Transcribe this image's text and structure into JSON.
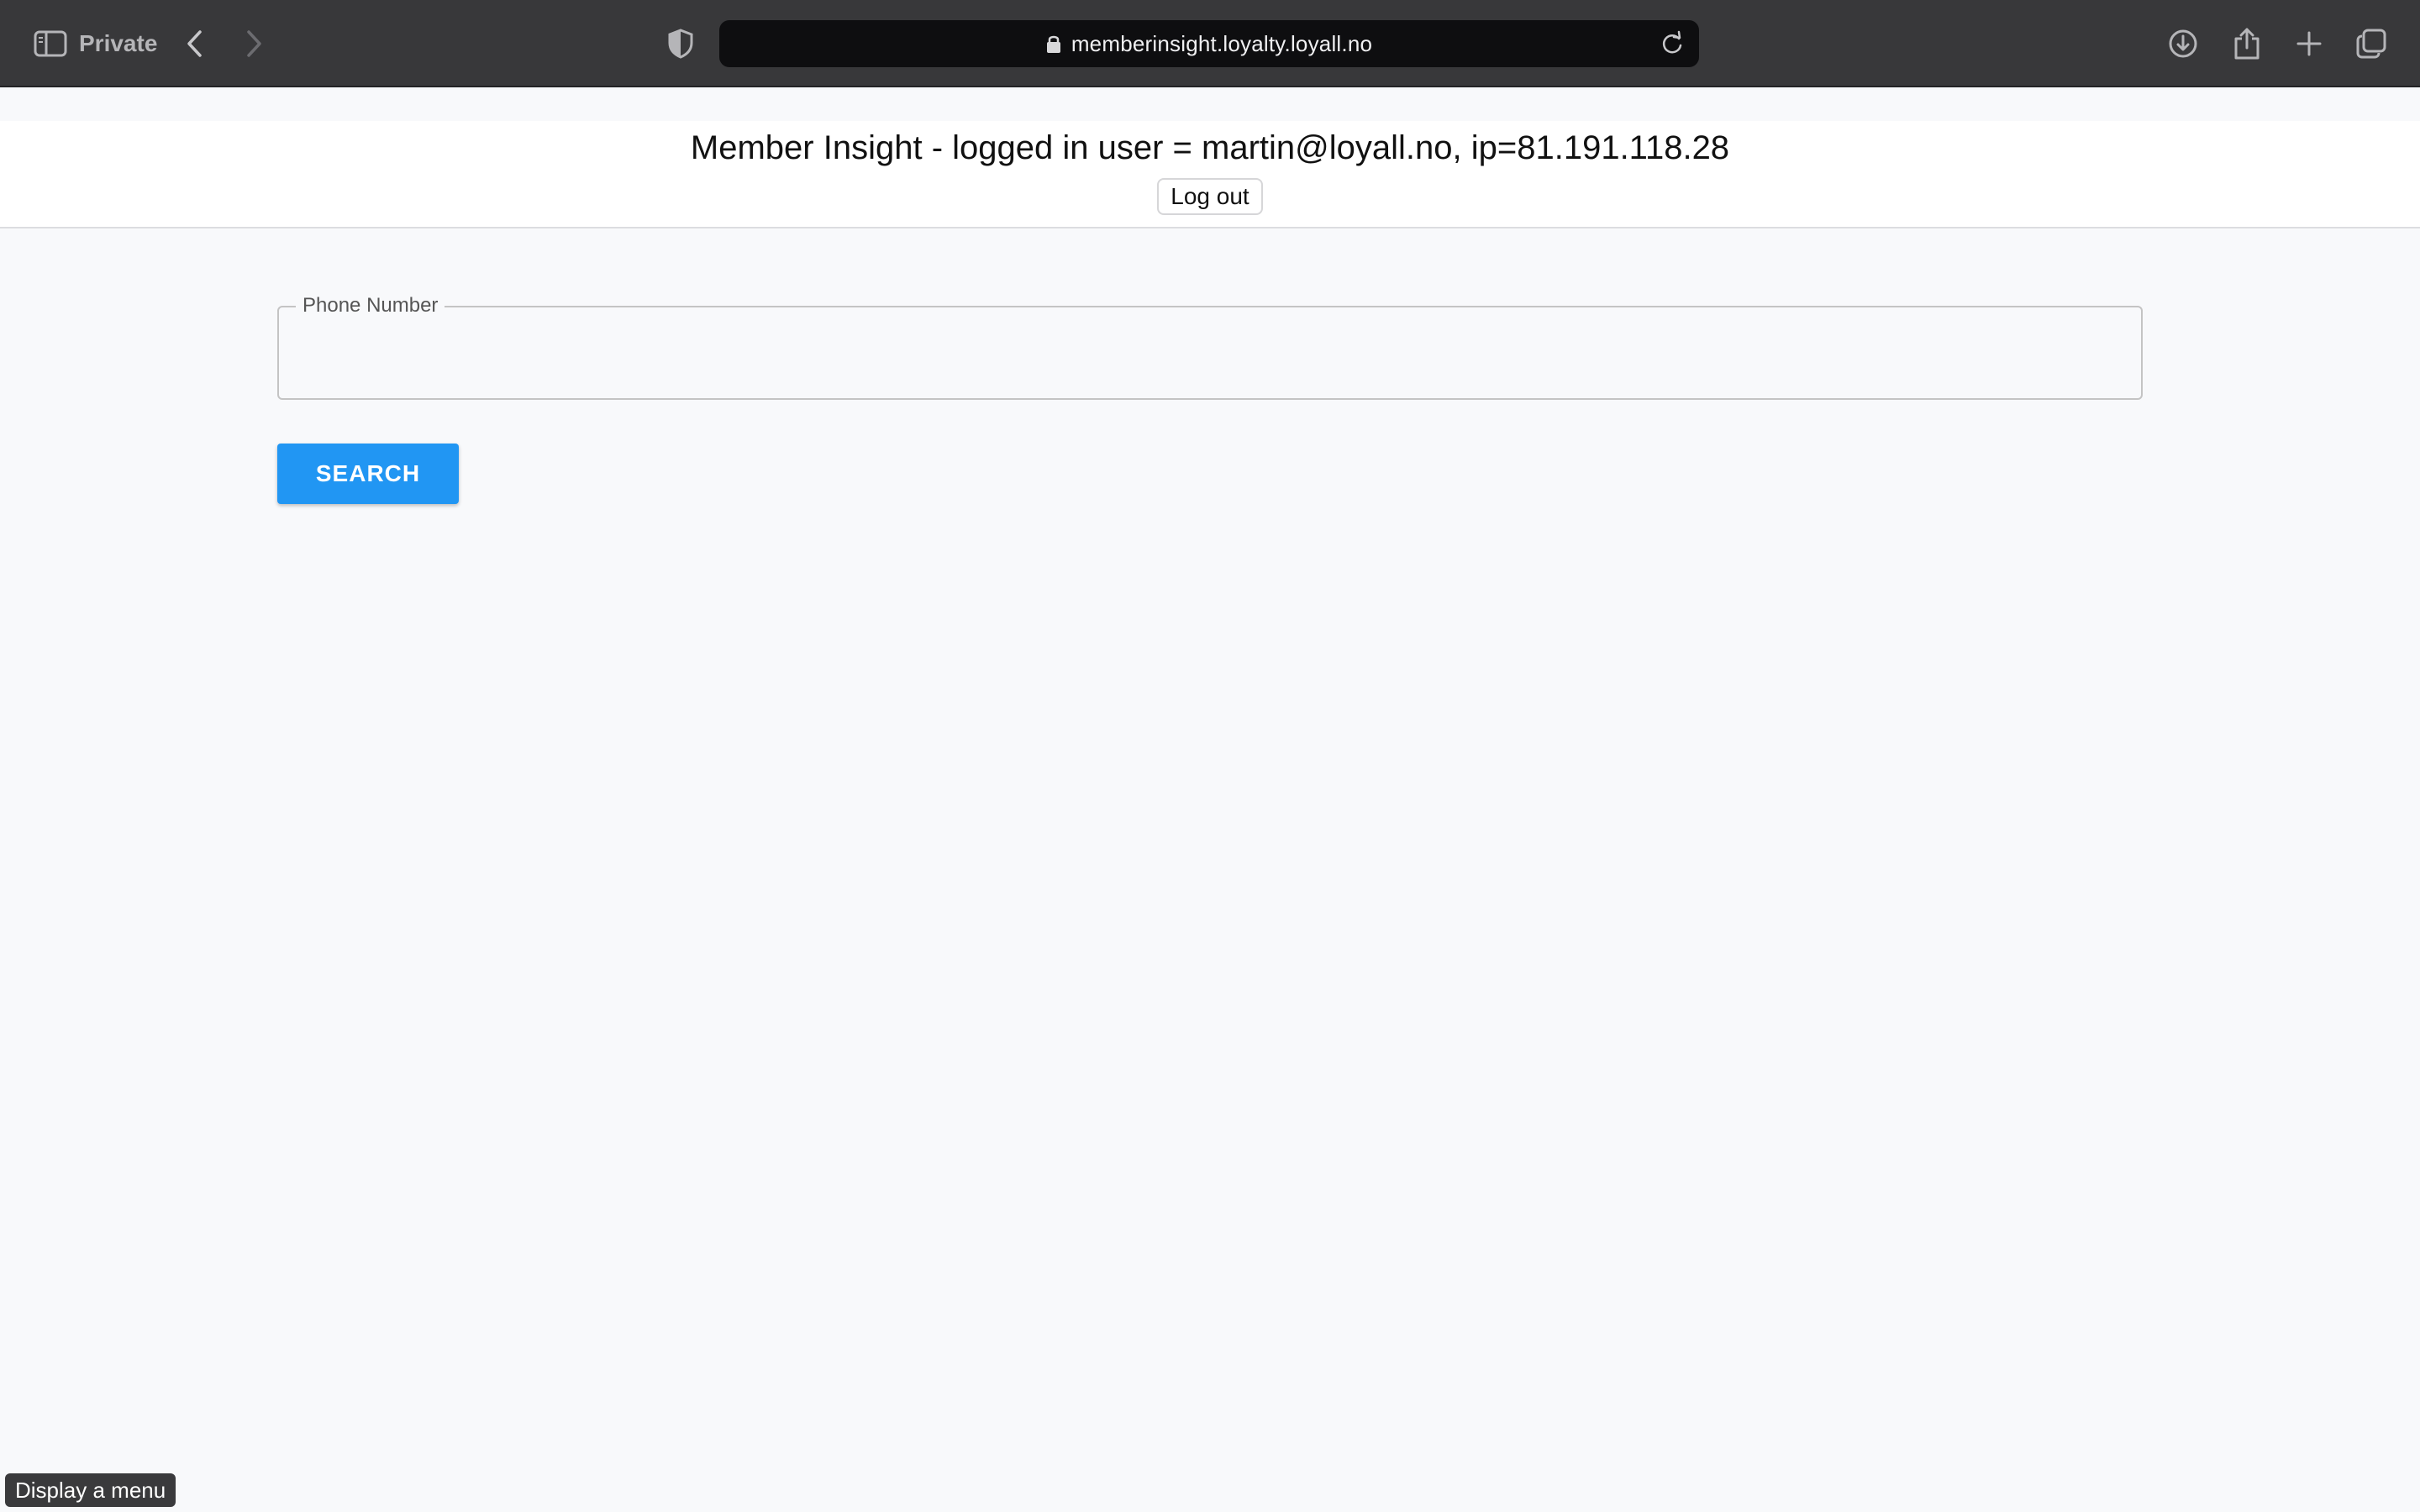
{
  "browser": {
    "private_label": "Private",
    "url": "memberinsight.loyalty.loyall.no",
    "icons": {
      "sidebar": "sidebar-icon",
      "back": "chevron-left-icon",
      "forward": "chevron-right-icon",
      "privacy": "shield-icon",
      "lock": "lock-icon",
      "reload": "reload-icon",
      "downloads": "download-icon",
      "share": "share-icon",
      "new_tab": "plus-icon",
      "tabs": "tabs-overview-icon"
    }
  },
  "header": {
    "title": "Member Insight - logged in user = martin@loyall.no, ip=81.191.118.28",
    "logout_label": "Log out"
  },
  "search": {
    "field_label": "Phone Number",
    "value": "",
    "button_label": "SEARCH"
  },
  "status_tooltip": "Display a menu",
  "colors": {
    "chrome_bg": "#38383a",
    "url_bar_bg": "#0e0e10",
    "page_bg": "#f8f9fb",
    "primary": "#2196f3"
  }
}
